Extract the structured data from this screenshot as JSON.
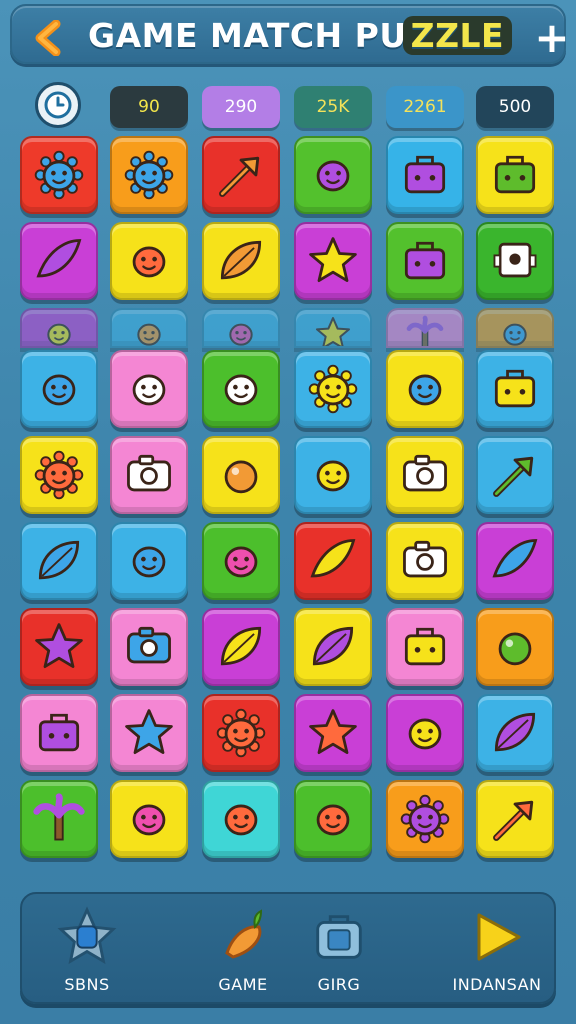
{
  "header": {
    "title_main": "GAME MATCH PU",
    "title_highlight": "ZZLE",
    "back_icon": "back-chevron-icon",
    "add_icon": "plus-icon",
    "add_label": "+"
  },
  "stats": [
    {
      "value": "90",
      "color": "#2b3a3f",
      "text": "#f3e64b"
    },
    {
      "value": "290",
      "color": "#b37ee6",
      "text": "#ffffff"
    },
    {
      "value": "25K",
      "color": "#2f8072",
      "text": "#f4e25a"
    },
    {
      "value": "2261",
      "color": "#3b95c9",
      "text": "#f4e25a"
    },
    {
      "value": "500",
      "color": "#22455a",
      "text": "#ffffff"
    }
  ],
  "timer_icon": "clock-icon",
  "tiles": [
    {
      "color": "#ee3a2a",
      "icon": "sun-icon"
    },
    {
      "color": "#f89d1b",
      "icon": "smiling-sun-icon"
    },
    {
      "color": "#e8312a",
      "icon": "rocket-icon"
    },
    {
      "color": "#53c12d",
      "icon": "blob-creature-icon"
    },
    {
      "color": "#36b3e8",
      "icon": "shopping-bag-icon"
    },
    {
      "color": "#f6e21a",
      "icon": "briefcase-icon"
    },
    {
      "color": "#c93fd6",
      "icon": "blue-crystal-icon"
    },
    {
      "color": "#f6e21a",
      "icon": "hand-icon"
    },
    {
      "color": "#f6e21a",
      "icon": "leaf-icon"
    },
    {
      "color": "#c93fd6",
      "icon": "star-icon"
    },
    {
      "color": "#53c12d",
      "icon": "purple-bag-icon"
    },
    {
      "color": "#3ab52d",
      "icon": "robot-icon"
    },
    {
      "color": "#3db2e6",
      "icon": "pink-blob-icon"
    },
    {
      "color": "#f486d3",
      "icon": "speech-bubble-icon"
    },
    {
      "color": "#4cbf2c",
      "icon": "chat-bubble-icon"
    },
    {
      "color": "#3db2e6",
      "icon": "sun-face-icon"
    },
    {
      "color": "#f6e21a",
      "icon": "ice-cream-icon"
    },
    {
      "color": "#3db2e6",
      "icon": "yellow-box-icon"
    },
    {
      "color": "#f6e21a",
      "icon": "flower-face-icon"
    },
    {
      "color": "#f486d3",
      "icon": "camera-icon"
    },
    {
      "color": "#f6e21a",
      "icon": "purple-orb-icon"
    },
    {
      "color": "#3db2e6",
      "icon": "pendant-icon"
    },
    {
      "color": "#f6e21a",
      "icon": "red-camera-icon"
    },
    {
      "color": "#3db2e6",
      "icon": "brush-icon"
    },
    {
      "color": "#3db2e6",
      "icon": "green-leaf-icon"
    },
    {
      "color": "#3db2e6",
      "icon": "fire-icon"
    },
    {
      "color": "#4cbf2c",
      "icon": "puzzle-piece-icon"
    },
    {
      "color": "#e8312a",
      "icon": "fish-icon"
    },
    {
      "color": "#f6e21a",
      "icon": "truck-icon"
    },
    {
      "color": "#c93fd6",
      "icon": "blue-swirl-icon"
    },
    {
      "color": "#e8312a",
      "icon": "blue-star-icon"
    },
    {
      "color": "#f486d3",
      "icon": "blue-camera-icon"
    },
    {
      "color": "#c93fd6",
      "icon": "green-pepper-icon"
    },
    {
      "color": "#f6e21a",
      "icon": "big-leaf-icon"
    },
    {
      "color": "#f486d3",
      "icon": "card-icon"
    },
    {
      "color": "#f89d1b",
      "icon": "berry-icon"
    },
    {
      "color": "#f486d3",
      "icon": "abacus-icon"
    },
    {
      "color": "#f486d3",
      "icon": "star-face-icon"
    },
    {
      "color": "#e8312a",
      "icon": "germ-icon"
    },
    {
      "color": "#c93fd6",
      "icon": "yellow-star-icon"
    },
    {
      "color": "#c93fd6",
      "icon": "smiley-oval-icon"
    },
    {
      "color": "#3db2e6",
      "icon": "feather-icon"
    },
    {
      "color": "#4cbf2c",
      "icon": "palm-tree-icon"
    },
    {
      "color": "#f6e21a",
      "icon": "blue-monster-icon"
    },
    {
      "color": "#3fd6d6",
      "icon": "pink-bubble-icon"
    },
    {
      "color": "#4cbf2c",
      "icon": "lemon-icon"
    },
    {
      "color": "#f89d1b",
      "icon": "flower-icon"
    },
    {
      "color": "#f6e21a",
      "icon": "arrow-icon"
    }
  ],
  "faded_row": [
    {
      "color": "#c93fd6",
      "icon": "pink-splash-icon"
    },
    {
      "color": "#3db2e6",
      "icon": "green-dino-icon"
    },
    {
      "color": "#3db2e6",
      "icon": "jar-icon"
    },
    {
      "color": "#3db2e6",
      "icon": "star-icon"
    },
    {
      "color": "#f486d3",
      "icon": "plant-icon"
    },
    {
      "color": "#f89d1b",
      "icon": "bug-icon"
    }
  ],
  "bottom_nav": [
    {
      "label": "SBNS",
      "icon": "badge-star-icon"
    },
    {
      "label": "GAME",
      "icon": "carrot-icon"
    },
    {
      "label": "GIRG",
      "icon": "bag-icon"
    },
    {
      "label": "INDANSAN",
      "icon": "play-triangle-icon"
    }
  ]
}
